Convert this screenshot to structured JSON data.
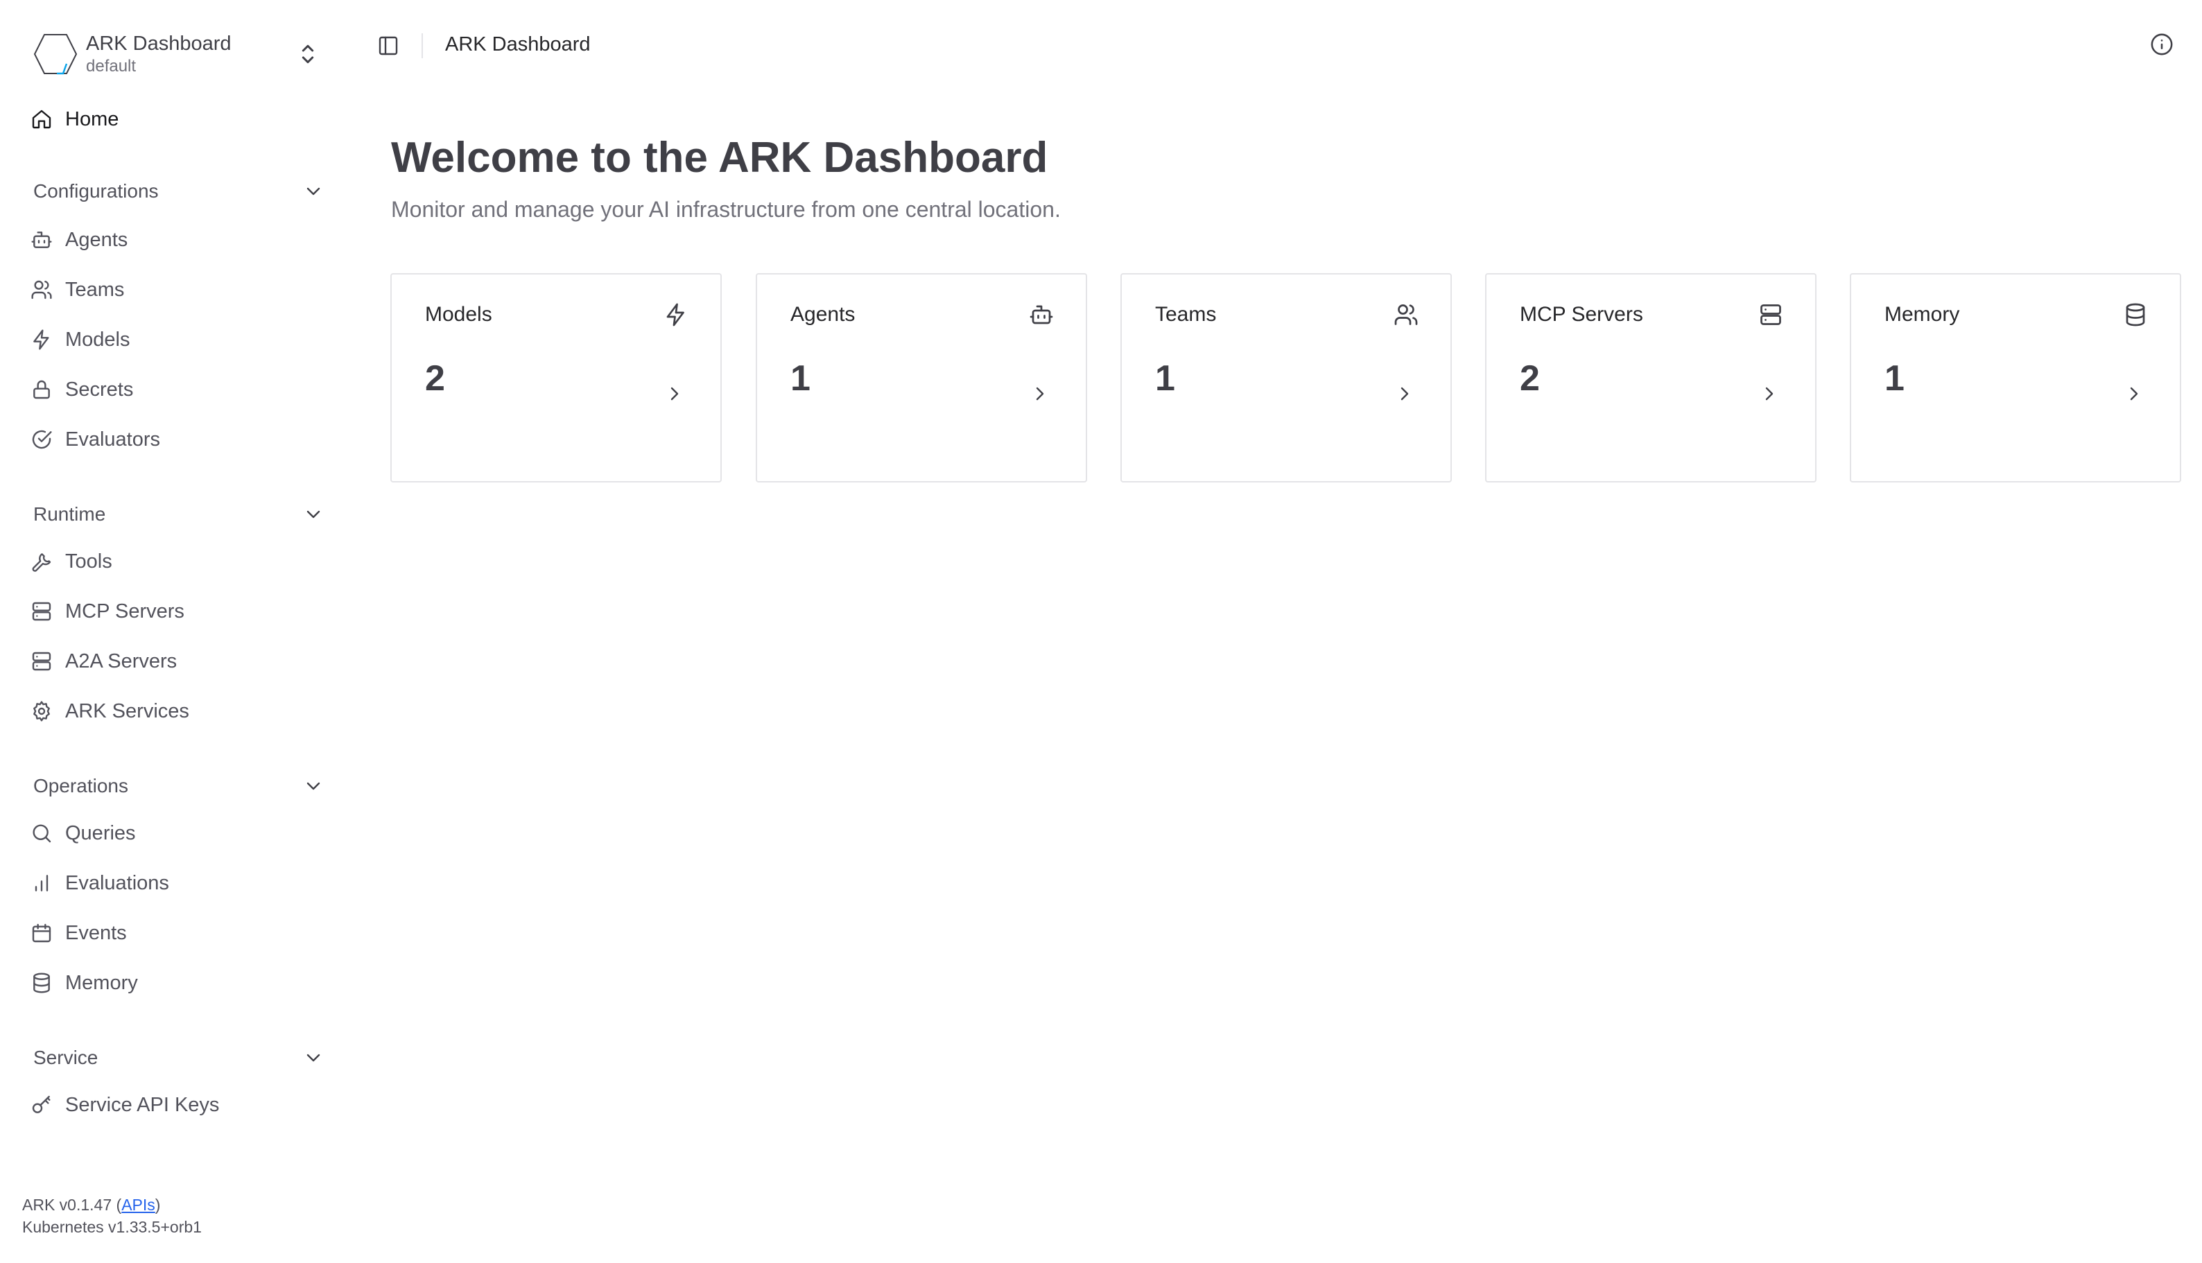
{
  "brand": {
    "title": "ARK Dashboard",
    "namespace": "default"
  },
  "sidebar": {
    "home": {
      "label": "Home",
      "icon": "home-icon"
    },
    "groups": [
      {
        "title": "Configurations",
        "items": [
          {
            "label": "Agents",
            "icon": "bot-icon"
          },
          {
            "label": "Teams",
            "icon": "users-icon"
          },
          {
            "label": "Models",
            "icon": "zap-icon"
          },
          {
            "label": "Secrets",
            "icon": "lock-icon"
          },
          {
            "label": "Evaluators",
            "icon": "check-circle-icon"
          }
        ]
      },
      {
        "title": "Runtime",
        "items": [
          {
            "label": "Tools",
            "icon": "wrench-icon"
          },
          {
            "label": "MCP Servers",
            "icon": "server-icon"
          },
          {
            "label": "A2A Servers",
            "icon": "server-icon"
          },
          {
            "label": "ARK Services",
            "icon": "gear-icon"
          }
        ]
      },
      {
        "title": "Operations",
        "items": [
          {
            "label": "Queries",
            "icon": "search-icon"
          },
          {
            "label": "Evaluations",
            "icon": "bar-chart-icon"
          },
          {
            "label": "Events",
            "icon": "calendar-icon"
          },
          {
            "label": "Memory",
            "icon": "database-icon"
          }
        ]
      },
      {
        "title": "Service",
        "items": [
          {
            "label": "Service API Keys",
            "icon": "key-icon"
          }
        ]
      }
    ]
  },
  "footer": {
    "version_prefix": "ARK v0.1.47 (",
    "apis_link": "APIs",
    "version_suffix": ")",
    "kubernetes": "Kubernetes v1.33.5+orb1"
  },
  "topbar": {
    "breadcrumb": "ARK Dashboard"
  },
  "main": {
    "title": "Welcome to the ARK Dashboard",
    "subtitle": "Monitor and manage your AI infrastructure from one central location.",
    "cards": [
      {
        "title": "Models",
        "value": "2",
        "icon": "zap-icon"
      },
      {
        "title": "Agents",
        "value": "1",
        "icon": "bot-icon"
      },
      {
        "title": "Teams",
        "value": "1",
        "icon": "users-icon"
      },
      {
        "title": "MCP Servers",
        "value": "2",
        "icon": "server-icon"
      },
      {
        "title": "Memory",
        "value": "1",
        "icon": "database-icon"
      }
    ]
  },
  "colors": {
    "text": "#3f3f46",
    "muted": "#71717a",
    "border": "#e4e4e7",
    "link": "#2563eb",
    "logo_accent": "#0ea5e9"
  }
}
